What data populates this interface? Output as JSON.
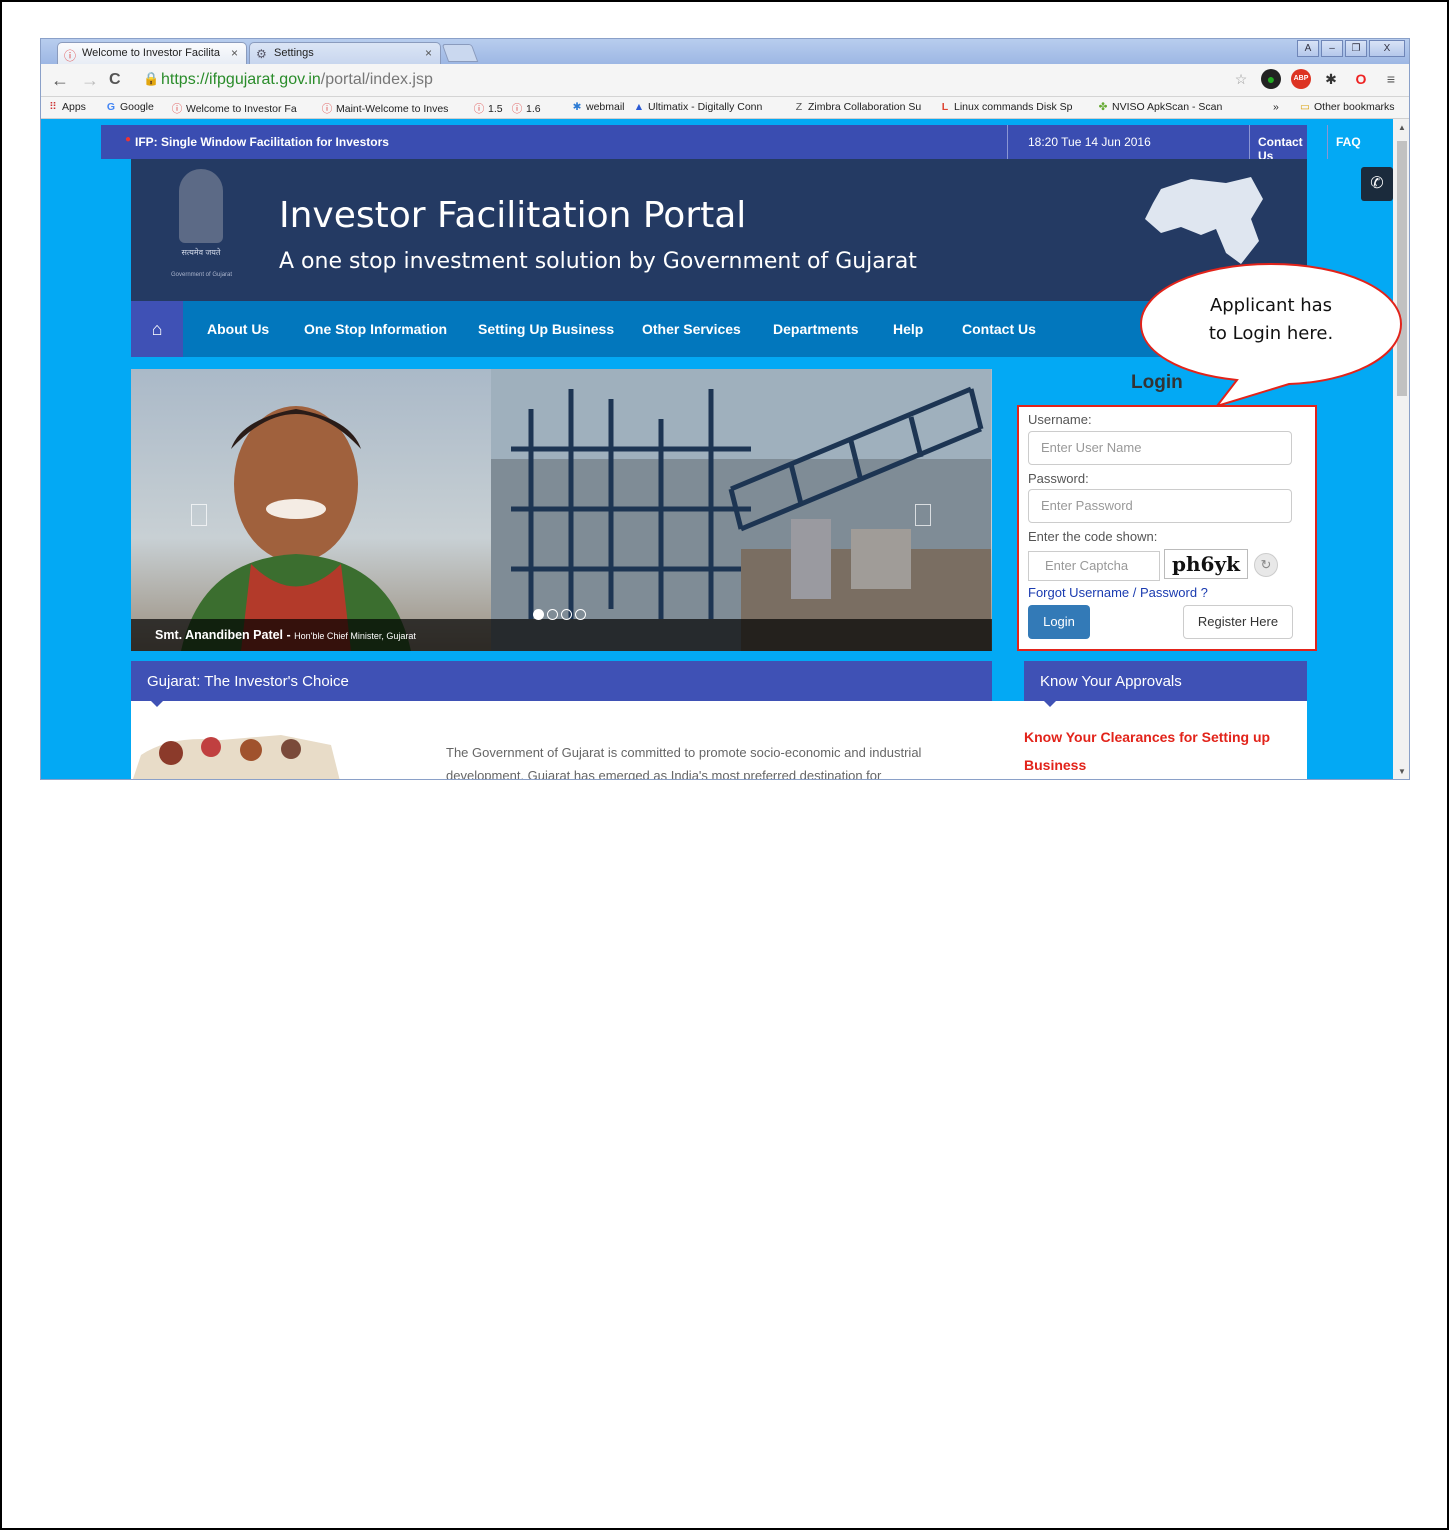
{
  "browser": {
    "tabs": [
      {
        "label": "Welcome to Investor Facilita",
        "icon": "site-favicon",
        "close": "×"
      },
      {
        "label": "Settings",
        "icon": "gear-icon",
        "close": "×"
      }
    ],
    "window_buttons": {
      "profile": "A",
      "minimize": "–",
      "maximize": "❐",
      "close": "X"
    },
    "url_host": "https://ifpgujarat.gov.in",
    "url_path": "/portal/index.jsp",
    "bookmarks": [
      "Apps",
      "Google",
      "Welcome to Investor Fa",
      "Maint-Welcome to Inves",
      "1.5",
      "1.6",
      "webmail",
      "Ultimatix - Digitally Conn",
      "Zimbra Collaboration Su",
      "Linux commands Disk Sp",
      "NVISO ApkScan - Scan",
      "»",
      "Other bookmarks"
    ]
  },
  "topbar": {
    "tagline": "IFP: Single Window Facilitation for Investors",
    "datetime": "18:20  Tue  14 Jun 2016",
    "contact": "Contact Us",
    "faq": "FAQ"
  },
  "header": {
    "title": "Investor Facilitation Portal",
    "subtitle": "A one stop investment solution by Government of Gujarat",
    "emblem_motto": "सत्यमेव जयते",
    "emblem_caption": "Government of Gujarat"
  },
  "nav": {
    "home_icon": "⌂",
    "items": [
      "About Us",
      "One Stop Information",
      "Setting Up Business",
      "Other Services",
      "Departments",
      "Help",
      "Contact Us"
    ]
  },
  "slider": {
    "caption_name": "Smt. Anandiben Patel - ",
    "caption_role": "Hon'ble Chief Minister, Gujarat",
    "current_slide": 1,
    "slide_count": 4
  },
  "login": {
    "heading": "Login",
    "username_label": "Username:",
    "username_placeholder": "Enter User Name",
    "password_label": "Password:",
    "password_placeholder": "Enter Password",
    "captcha_label": "Enter the code shown:",
    "captcha_placeholder": "Enter Captcha",
    "captcha_code": "ph6yk",
    "forgot": "Forgot Username / Password ?",
    "login_button": "Login",
    "register_button": "Register Here"
  },
  "sections": {
    "investor_choice": "Gujarat: The Investor's Choice",
    "intro_text": "The Government of Gujarat is committed to promote socio-economic and industrial development. Gujarat has emerged as India's most preferred destination for",
    "approvals_heading": "Know Your Approvals",
    "approvals_link": "Know Your Clearances for Setting up Business"
  },
  "callout": {
    "line1": "Applicant has",
    "line2": "to Login here."
  },
  "colors": {
    "page_bg": "#03a9f4",
    "topbar": "#3a4db1",
    "banner": "#243a63",
    "navbar": "#0277bd",
    "section_header": "#3f51b5",
    "highlight": "#e2231a"
  }
}
